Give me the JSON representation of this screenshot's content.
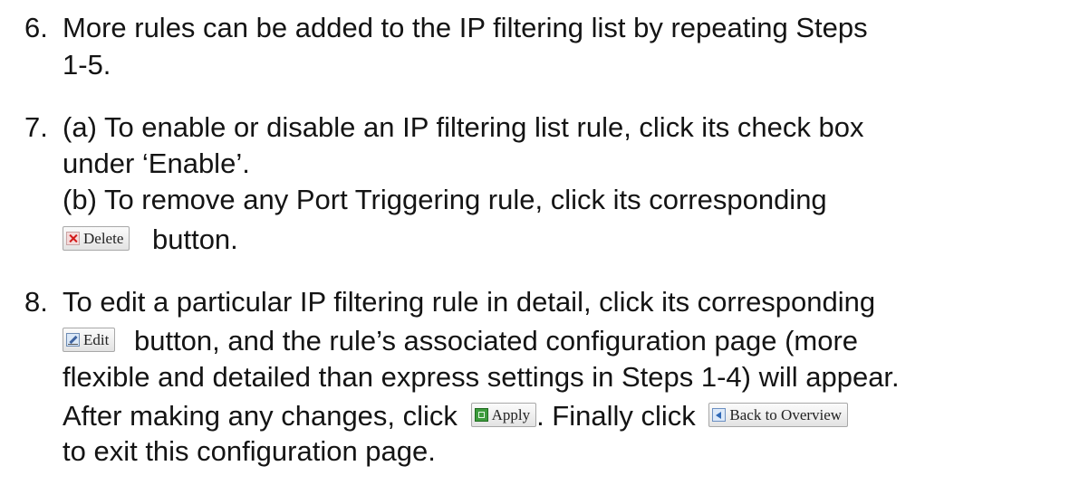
{
  "steps": [
    {
      "number": "6.",
      "lines": [
        "More rules can be added to the IP filtering list by repeating Steps",
        "1-5."
      ]
    },
    {
      "number": "7.",
      "lines": [
        "(a) To enable or disable an IP filtering list rule, click its check box",
        "under ‘Enable’.",
        "(b) To remove any Port Triggering rule, click its corresponding"
      ],
      "after_delete": "button."
    },
    {
      "number": "8.",
      "lines": [
        "To edit a particular IP filtering rule in detail, click its corresponding"
      ],
      "after_edit": "button, and the rule’s associated configuration page (more",
      "line3": "flexible and detailed than express settings in Steps 1-4) will appear.",
      "line4_before_apply": "After making any changes, click",
      "line4_between": ". Finally click",
      "line5": "to exit this configuration page."
    }
  ],
  "buttons": {
    "delete": {
      "label": "Delete",
      "icon": "delete-x-icon"
    },
    "edit": {
      "label": "Edit",
      "icon": "edit-pencil-icon"
    },
    "apply": {
      "label": "Apply",
      "icon": "apply-green-icon"
    },
    "back": {
      "label": "Back to Overview",
      "icon": "back-arrow-icon"
    }
  }
}
